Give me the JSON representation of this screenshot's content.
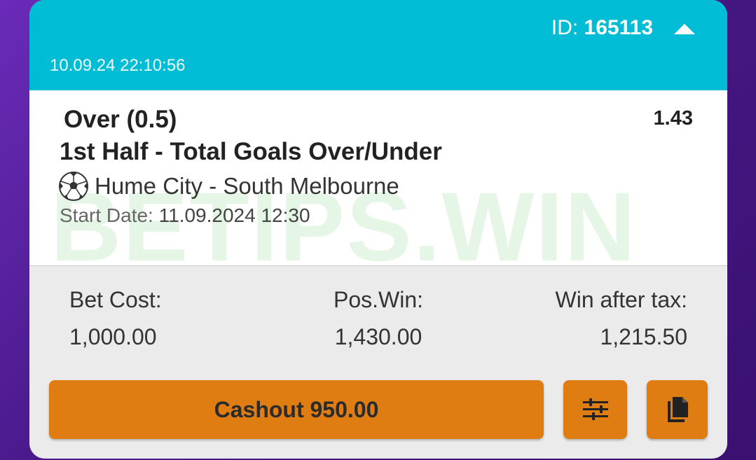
{
  "header": {
    "id_label": "ID:",
    "id_value": "165113",
    "timestamp": "10.09.24 22:10:56",
    "collapse_icon": "chevron-up-icon"
  },
  "watermark": "BETIPS.WIN",
  "bet": {
    "selection": "Over (0.5)",
    "odds": "1.43",
    "market": "1st Half - Total Goals Over/Under",
    "sport_icon": "soccer-ball-icon",
    "match": "Hume City - South Melbourne",
    "start_date_label": "Start Date:",
    "start_date_value": "11.09.2024 12:30"
  },
  "stats": {
    "bet_cost_label": "Bet Cost:",
    "bet_cost_value": "1,000.00",
    "pos_win_label": "Pos.Win:",
    "pos_win_value": "1,430.00",
    "win_after_tax_label": "Win after tax:",
    "win_after_tax_value": "1,215.50"
  },
  "actions": {
    "cashout_label": "Cashout 950.00",
    "settings_icon": "sliders-icon",
    "copy_icon": "copy-icon"
  },
  "colors": {
    "header_bg": "#00bcd4",
    "button_bg": "#e07d12",
    "background_purple": "#4a1a8c"
  }
}
